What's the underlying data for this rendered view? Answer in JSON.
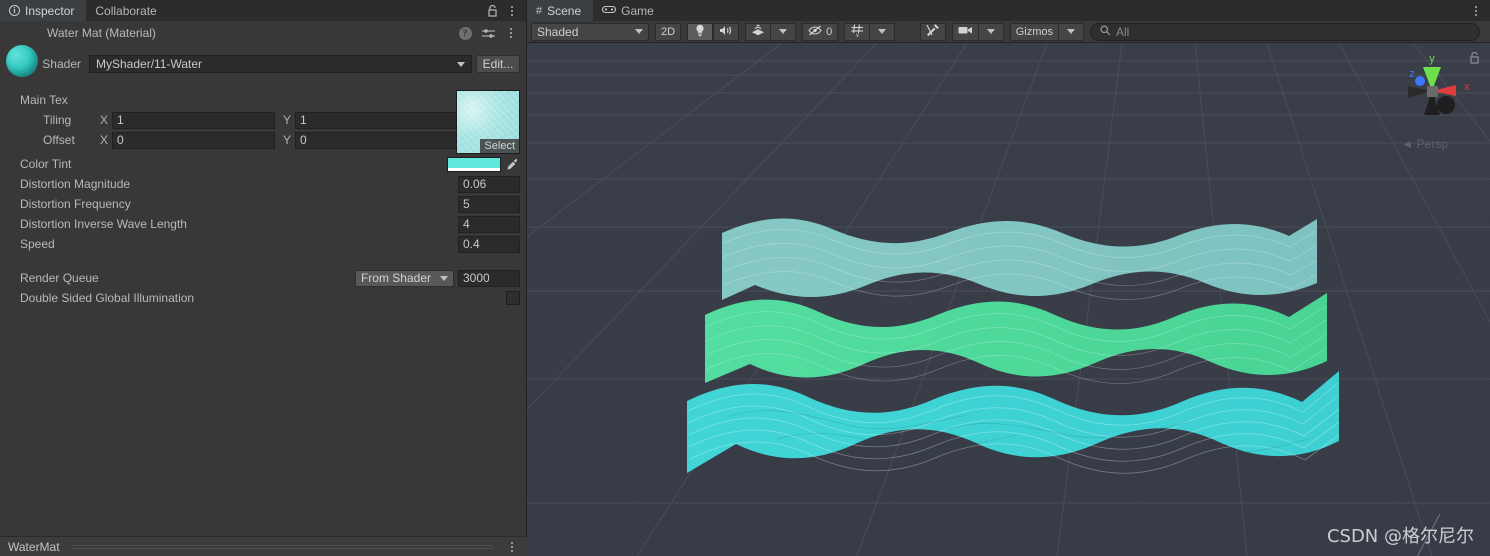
{
  "inspector": {
    "tabs": [
      {
        "label": "Inspector",
        "icon": "info-icon",
        "active": true
      },
      {
        "label": "Collaborate",
        "icon": null,
        "active": false
      }
    ],
    "header_icons": [
      "lock-icon",
      "kebab-menu-icon"
    ],
    "material": {
      "title": "Water Mat (Material)",
      "preview_icon": "material-sphere-icon",
      "actions": [
        "help-icon",
        "preset-icon",
        "kebab-menu-icon"
      ]
    },
    "shader": {
      "label": "Shader",
      "value": "MyShader/11-Water",
      "edit_label": "Edit..."
    },
    "main_tex": {
      "label": "Main Tex",
      "select_label": "Select",
      "tiling": {
        "label": "Tiling",
        "x_axis": "X",
        "x": "1",
        "y_axis": "Y",
        "y": "1"
      },
      "offset": {
        "label": "Offset",
        "x_axis": "X",
        "x": "0",
        "y_axis": "Y",
        "y": "0"
      }
    },
    "properties": [
      {
        "label": "Color Tint",
        "type": "color",
        "value": "#5fe8dc"
      },
      {
        "label": "Distortion Magnitude",
        "type": "number",
        "value": "0.06"
      },
      {
        "label": "Distortion Frequency",
        "type": "number",
        "value": "5"
      },
      {
        "label": "Distortion Inverse Wave Length",
        "type": "number",
        "value": "4"
      },
      {
        "label": "Speed",
        "type": "number",
        "value": "0.4"
      }
    ],
    "render_queue": {
      "label": "Render Queue",
      "mode": "From Shader",
      "value": "3000"
    },
    "double_sided_gi": {
      "label": "Double Sided Global Illumination",
      "checked": false
    },
    "footer": {
      "name": "WaterMat"
    }
  },
  "scene": {
    "tabs": [
      {
        "label": "Scene",
        "icon": "grid-icon",
        "active": true
      },
      {
        "label": "Game",
        "icon": "gamepad-icon",
        "active": false
      }
    ],
    "window_menu_icon": "kebab-menu-icon",
    "toolbar": {
      "draw_mode": "Shaded",
      "two_d_label": "2D",
      "lighting_icon": "lightbulb-icon",
      "audio_icon": "speaker-icon",
      "fx_icon": "effects-icon",
      "hidden_icon": "hidden-eye-icon",
      "hidden_count": "0",
      "grid_icon": "grid-snap-icon",
      "tools_icon": "tools-icon",
      "camera_icon": "camera-icon",
      "gizmos_label": "Gizmos",
      "search_placeholder": "All",
      "search_icon": "search-icon",
      "search_value": ""
    },
    "gizmo": {
      "axes": [
        {
          "label": "y",
          "color": "#6ee04a"
        },
        {
          "label": "z",
          "color": "#3c78ff"
        },
        {
          "label": "x",
          "color": "#e03c3c"
        }
      ],
      "projection_label": "Persp",
      "lock_icon": "lock-icon"
    },
    "background_color": "#393d47",
    "grid_color": "#4e525c",
    "meshes": [
      {
        "name": "water-ribbon-back",
        "color": "#7ec4c0"
      },
      {
        "name": "water-ribbon-middle",
        "color": "#4fd99a"
      },
      {
        "name": "water-ribbon-front",
        "color": "#3fd3d5"
      }
    ],
    "watermark": "CSDN @格尔尼尔"
  }
}
